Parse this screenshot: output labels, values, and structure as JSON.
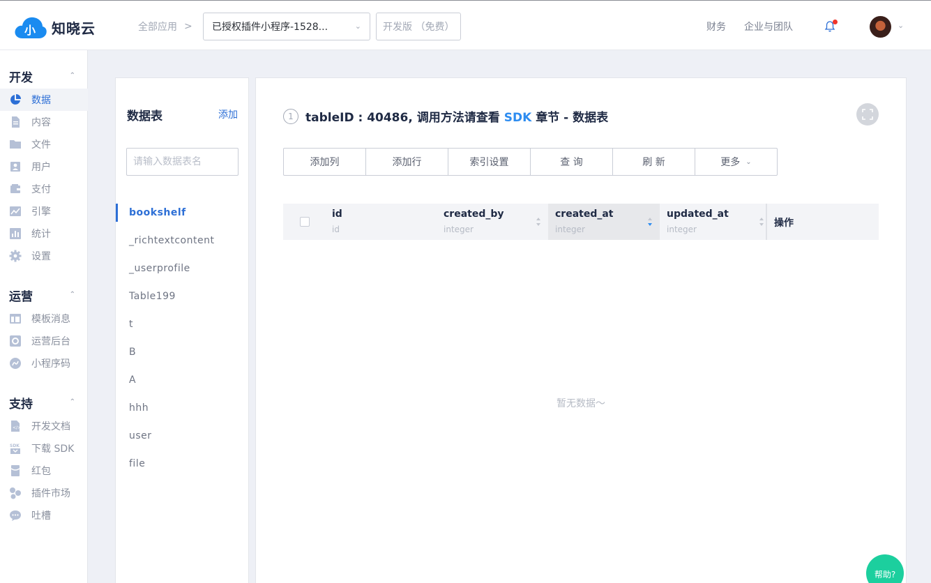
{
  "brand": {
    "name": "知晓云"
  },
  "header": {
    "breadcrumb": "全部应用",
    "app_select": "已授权插件小程序-1528...",
    "plan": "开发版 （免费）",
    "links": [
      "财务",
      "企业与团队"
    ]
  },
  "sidebar": {
    "sections": [
      {
        "title": "开发",
        "items": [
          {
            "label": "数据",
            "icon": "pie-chart-icon",
            "active": true
          },
          {
            "label": "内容",
            "icon": "document-icon"
          },
          {
            "label": "文件",
            "icon": "folder-icon"
          },
          {
            "label": "用户",
            "icon": "user-card-icon"
          },
          {
            "label": "支付",
            "icon": "wallet-icon"
          },
          {
            "label": "引擎",
            "icon": "trend-icon"
          },
          {
            "label": "统计",
            "icon": "bar-chart-icon"
          },
          {
            "label": "设置",
            "icon": "gear-icon"
          }
        ]
      },
      {
        "title": "运营",
        "items": [
          {
            "label": "模板消息",
            "icon": "template-icon"
          },
          {
            "label": "运营后台",
            "icon": "dashboard-icon"
          },
          {
            "label": "小程序码",
            "icon": "link-icon"
          }
        ]
      },
      {
        "title": "支持",
        "items": [
          {
            "label": "开发文档",
            "icon": "code-doc-icon"
          },
          {
            "label": "下载 SDK",
            "icon": "sdk-download-icon"
          },
          {
            "label": "红包",
            "icon": "red-packet-icon"
          },
          {
            "label": "插件市场",
            "icon": "plugin-icon"
          },
          {
            "label": "吐槽",
            "icon": "chat-bubble-icon"
          }
        ]
      }
    ]
  },
  "tables_panel": {
    "title": "数据表",
    "add_label": "添加",
    "search_placeholder": "请输入数据表名",
    "tables": [
      "bookshelf",
      "_richtextcontent",
      "_userprofile",
      "Table199",
      "t",
      "B",
      "A",
      "hhh",
      "user",
      "file"
    ],
    "active_index": 0
  },
  "main": {
    "step": "1",
    "info_prefix": "tableID : 40486,  调用方法请查看",
    "info_sdk": "SDK",
    "info_suffix": "章节 - 数据表",
    "toolbar": [
      "添加列",
      "添加行",
      "索引设置",
      "查 询",
      "刷 新",
      "更多"
    ],
    "columns": [
      {
        "name": "id",
        "type": "id",
        "sortable": false
      },
      {
        "name": "created_by",
        "type": "integer",
        "sortable": true
      },
      {
        "name": "created_at",
        "type": "integer",
        "sortable": true,
        "highlighted": true
      },
      {
        "name": "updated_at",
        "type": "integer",
        "sortable": true
      }
    ],
    "ops_label": "操作",
    "empty_text": "暂无数据～"
  },
  "help_label": "帮助?",
  "colors": {
    "accent": "#2d6fd6",
    "link": "#2d8cf0",
    "help": "#1ccf9e",
    "notify": "#f0342b"
  }
}
